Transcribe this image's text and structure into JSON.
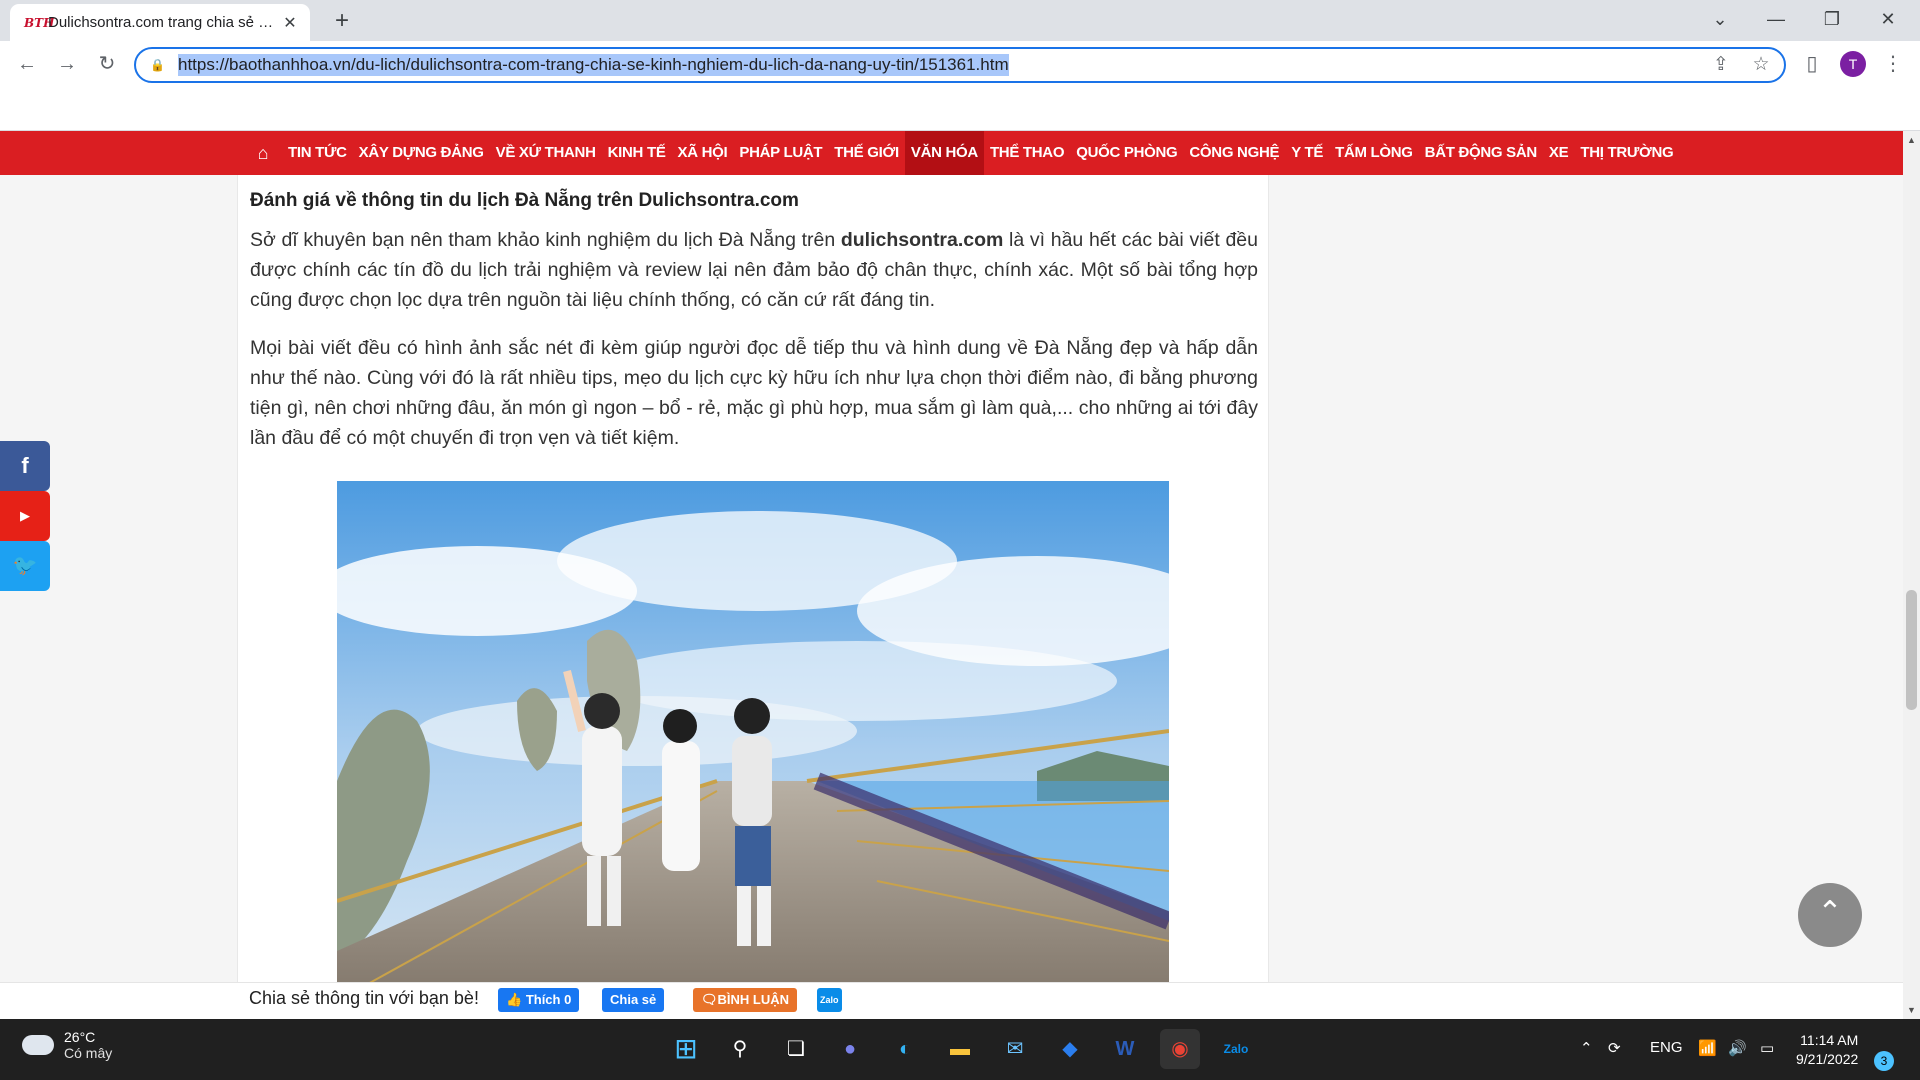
{
  "browser": {
    "tab_title": "Dulichsontra.com trang chia sẻ kinh nghiệm du lịch Đà Nẵng uy tín",
    "favicon_text": "BTH",
    "url": "https://baothanhhoa.vn/du-lich/dulichsontra-com-trang-chia-se-kinh-nghiem-du-lich-da-nang-uy-tin/151361.htm",
    "profile_initial": "T"
  },
  "nav": {
    "items": [
      "TIN TỨC",
      "XÂY DỰNG ĐẢNG",
      "VỀ XỨ THANH",
      "KINH TẾ",
      "XÃ HỘI",
      "PHÁP LUẬT",
      "THẾ GIỚI",
      "VĂN HÓA",
      "THỂ THAO",
      "QUỐC PHÒNG",
      "CÔNG NGHỆ",
      "Y TẾ",
      "TẤM LÒNG",
      "BẤT ĐỘNG SẢN",
      "XE",
      "THỊ TRƯỜNG"
    ],
    "active": "VĂN HÓA"
  },
  "article": {
    "heading": "Đánh giá về thông tin du lịch Đà Nẵng trên Dulichsontra.com",
    "p1_before": "Sở dĩ khuyên bạn nên tham khảo kinh nghiệm du lịch Đà Nẵng trên ",
    "p1_bold": "dulichsontra.com",
    "p1_after": " là vì hầu hết các bài viết đều được chính các tín đồ du lịch trải nghiệm và review lại nên đảm bảo độ chân thực, chính xác. Một số bài tổng hợp cũng được chọn lọc dựa trên nguồn tài liệu chính thống, có căn cứ rất đáng tin.",
    "p2": "Mọi bài viết đều có hình ảnh sắc nét đi kèm giúp người đọc dễ tiếp thu và hình dung về Đà Nẵng đẹp và hấp dẫn như thế nào. Cùng với đó là rất nhiều tips, mẹo du lịch cực kỳ hữu ích như lựa chọn thời điểm nào, đi bằng phương tiện gì, nên chơi những đâu, ăn món gì ngon – bổ - rẻ, mặc gì phù hợp, mua sắm gì làm quà,... cho những ai tới đây lần đầu để có một chuyến đi trọn vẹn và tiết kiệm."
  },
  "share": {
    "label": "Chia sẻ thông tin với bạn bè!",
    "like": "Thích 0",
    "share": "Chia sẻ",
    "comment": "BÌNH LUẬN",
    "zalo": "Zalo"
  },
  "social": [
    "facebook-icon",
    "youtube-icon",
    "twitter-icon"
  ],
  "taskbar": {
    "temp": "26°C",
    "condition": "Có mây",
    "lang": "ENG",
    "time": "11:14 AM",
    "date": "9/21/2022",
    "notifications": "3"
  },
  "colors": {
    "nav_red": "#da1e22",
    "facebook": "#3b5998",
    "youtube": "#e62117",
    "twitter": "#1da1f2",
    "chrome_accent": "#1a73e8"
  }
}
